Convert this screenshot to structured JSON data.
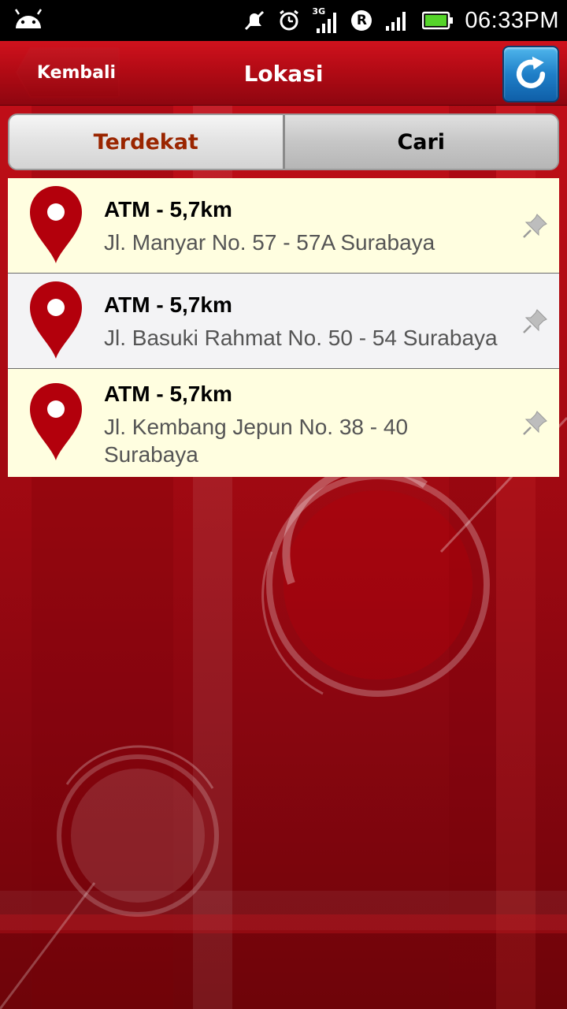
{
  "status_bar": {
    "time": "06:33PM",
    "network": "3G",
    "roaming": "R"
  },
  "header": {
    "back_label": "Kembali",
    "title": "Lokasi"
  },
  "tabs": [
    {
      "label": "Terdekat",
      "active": true
    },
    {
      "label": "Cari",
      "active": false
    }
  ],
  "locations": [
    {
      "name": "ATM - 5,7km",
      "address": "Jl. Manyar No. 57 - 57A Surabaya"
    },
    {
      "name": "ATM - 5,7km",
      "address": "Jl. Basuki Rahmat No. 50 - 54 Surabaya"
    },
    {
      "name": "ATM - 5,7km",
      "address": "Jl. Kembang Jepun No. 38 - 40 Surabaya"
    }
  ],
  "colors": {
    "header_red": "#b00a14",
    "active_tab_text": "#9a2500",
    "list_bg_odd": "#fffee0",
    "list_bg_even": "#f3f3f5",
    "pin_red": "#b3000c",
    "refresh_blue": "#1f7fc8"
  },
  "icons": {
    "status": [
      "android-icon",
      "mute-icon",
      "alarm-icon",
      "signal-icon",
      "roaming-icon",
      "wifi-signal-icon",
      "battery-icon"
    ],
    "header": [
      "back-arrow-icon",
      "refresh-icon"
    ],
    "list": [
      "map-pin-icon",
      "pushpin-icon"
    ]
  }
}
